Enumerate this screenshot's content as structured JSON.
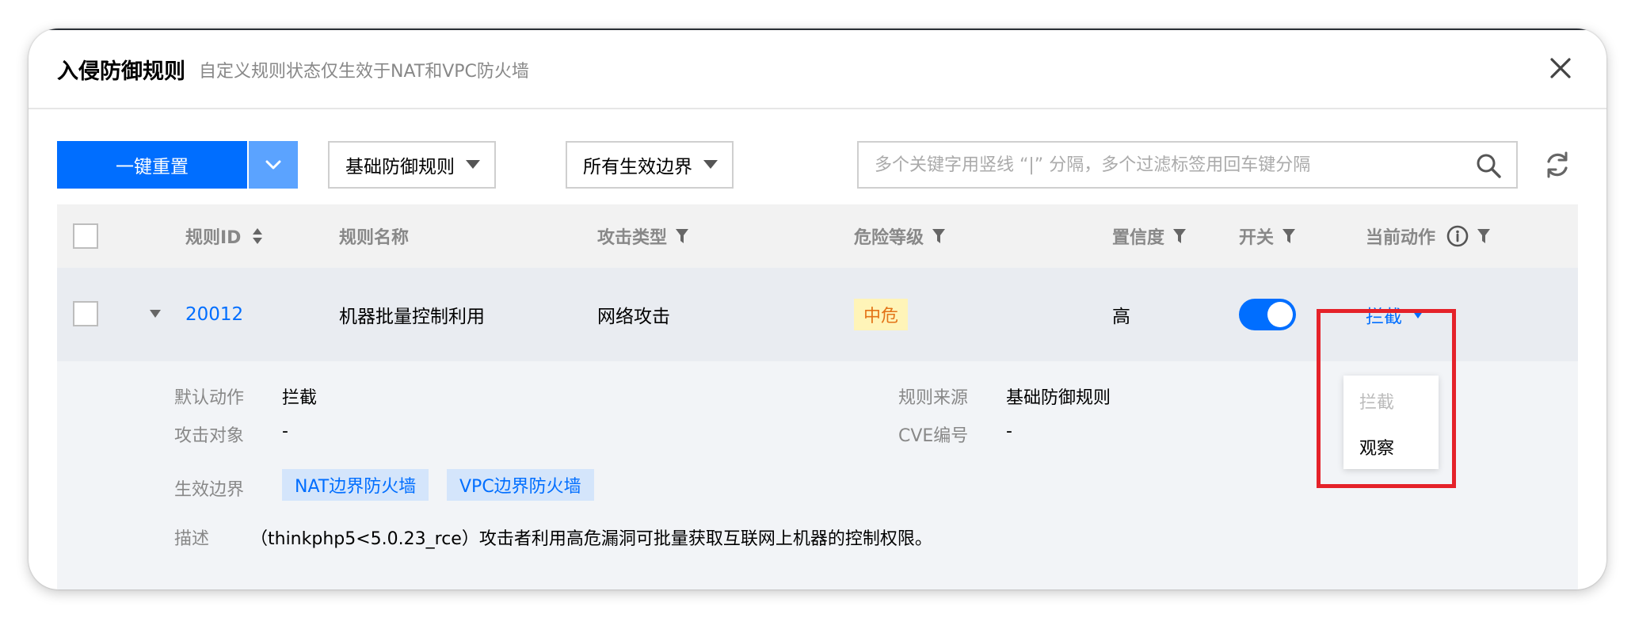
{
  "dialog": {
    "title": "入侵防御规则",
    "subtitle": "自定义规则状态仅生效于NAT和VPC防火墙"
  },
  "toolbar": {
    "reset_label": "一键重置",
    "rule_type_select": "基础防御规则",
    "boundary_select": "所有生效边界",
    "search_placeholder": "多个关键字用竖线 “|” 分隔，多个过滤标签用回车键分隔"
  },
  "table": {
    "columns": {
      "rule_id": "规则ID",
      "rule_name": "规则名称",
      "attack_type": "攻击类型",
      "risk_level": "危险等级",
      "confidence": "置信度",
      "switch": "开关",
      "current_action": "当前动作"
    },
    "rows": [
      {
        "rule_id": "20012",
        "rule_name": "机器批量控制利用",
        "attack_type": "网络攻击",
        "risk_level": "中危",
        "confidence": "高",
        "switch_on": true,
        "current_action": "拦截"
      }
    ]
  },
  "details": {
    "default_action_label": "默认动作",
    "default_action_value": "拦截",
    "attack_target_label": "攻击对象",
    "attack_target_value": "-",
    "rule_source_label": "规则来源",
    "rule_source_value": "基础防御规则",
    "cve_label": "CVE编号",
    "cve_value": "-",
    "boundary_label": "生效边界",
    "boundary_tags": [
      "NAT边界防火墙",
      "VPC边界防火墙"
    ],
    "description_label": "描述",
    "description_value": "（thinkphp5<5.0.23_rce）攻击者利用高危漏洞可批量获取互联网上机器的控制权限。"
  },
  "action_menu": {
    "items": [
      "拦截",
      "观察"
    ]
  },
  "colors": {
    "primary": "#006eff",
    "warning_bg": "#fff4b8",
    "warning_text": "#e37317",
    "highlight": "#e5222a"
  }
}
